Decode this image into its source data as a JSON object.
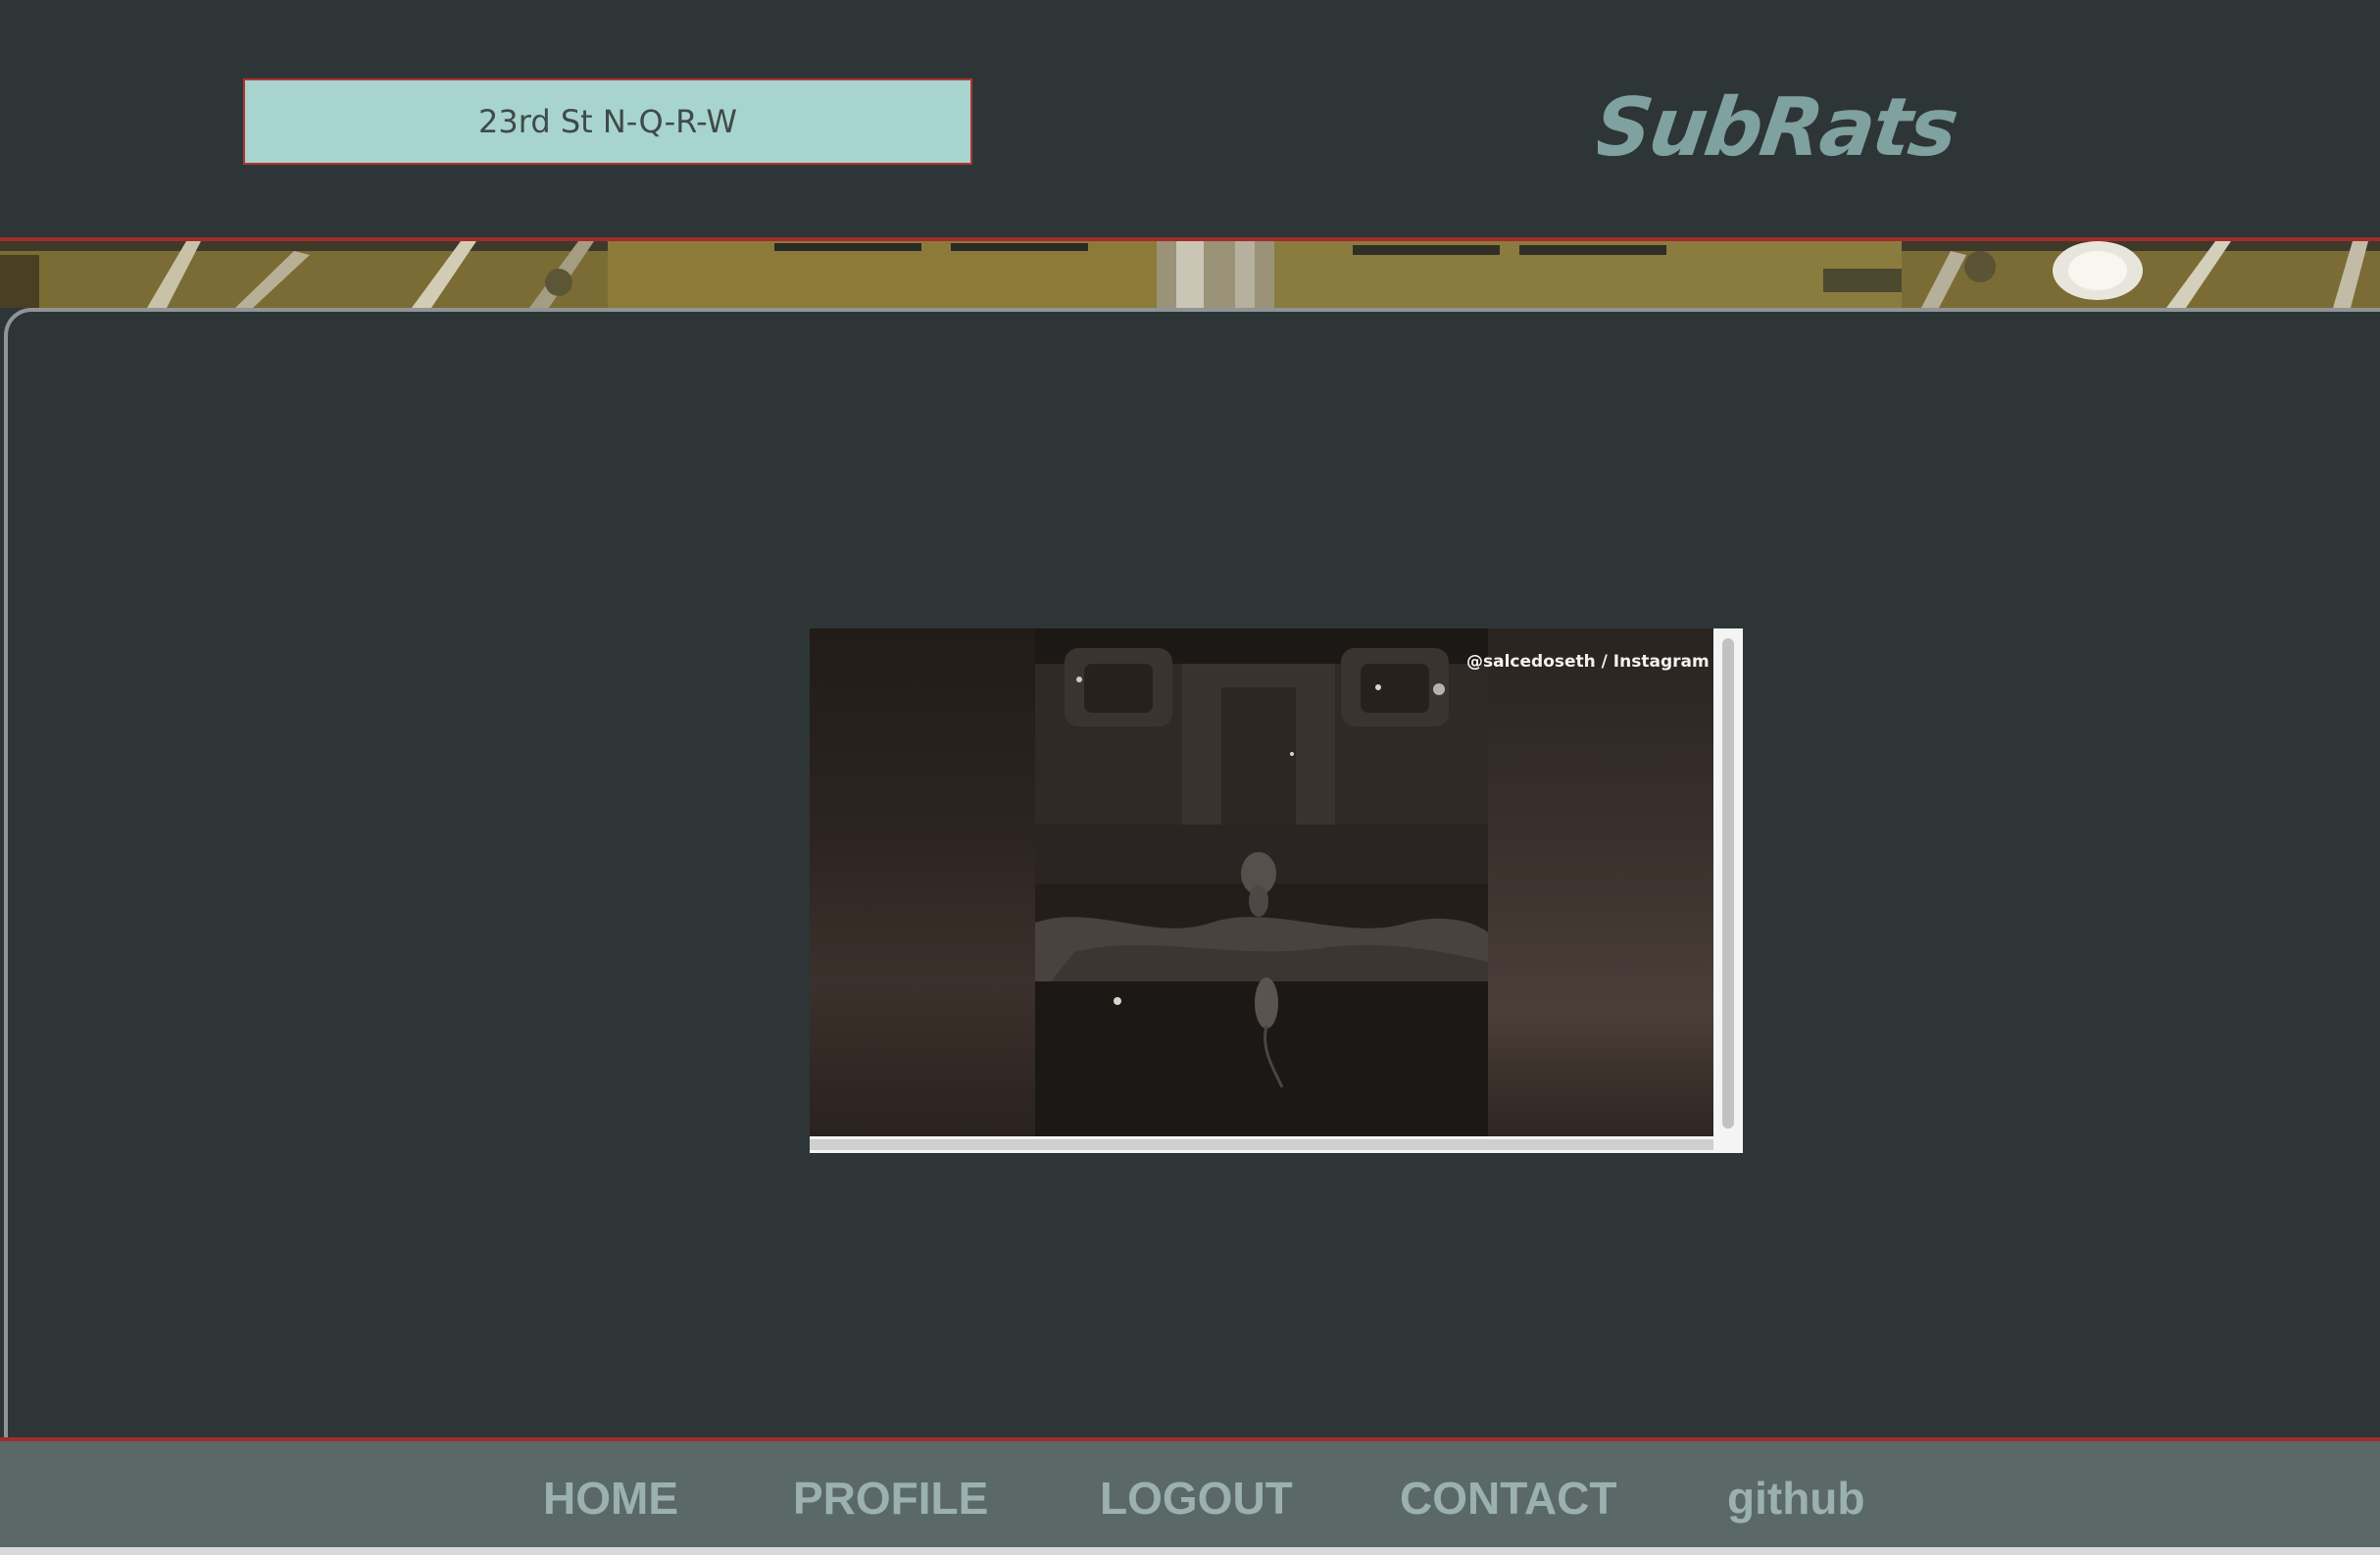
{
  "header": {
    "station_value": "23rd St N-Q-R-W",
    "brand": "SubRats"
  },
  "video": {
    "credit": "@salcedoseth / Instagram"
  },
  "footer": {
    "nav": [
      "HOME",
      "PROFILE",
      "LOGOUT",
      "CONTACT",
      "github"
    ]
  },
  "colors": {
    "background": "#2e3537",
    "accent_border": "#a52a2a",
    "select_bg": "#a8d4cf",
    "brand_text": "#7fa19f",
    "footer_bg": "#5a6868",
    "footer_link": "#9bb1b0"
  }
}
